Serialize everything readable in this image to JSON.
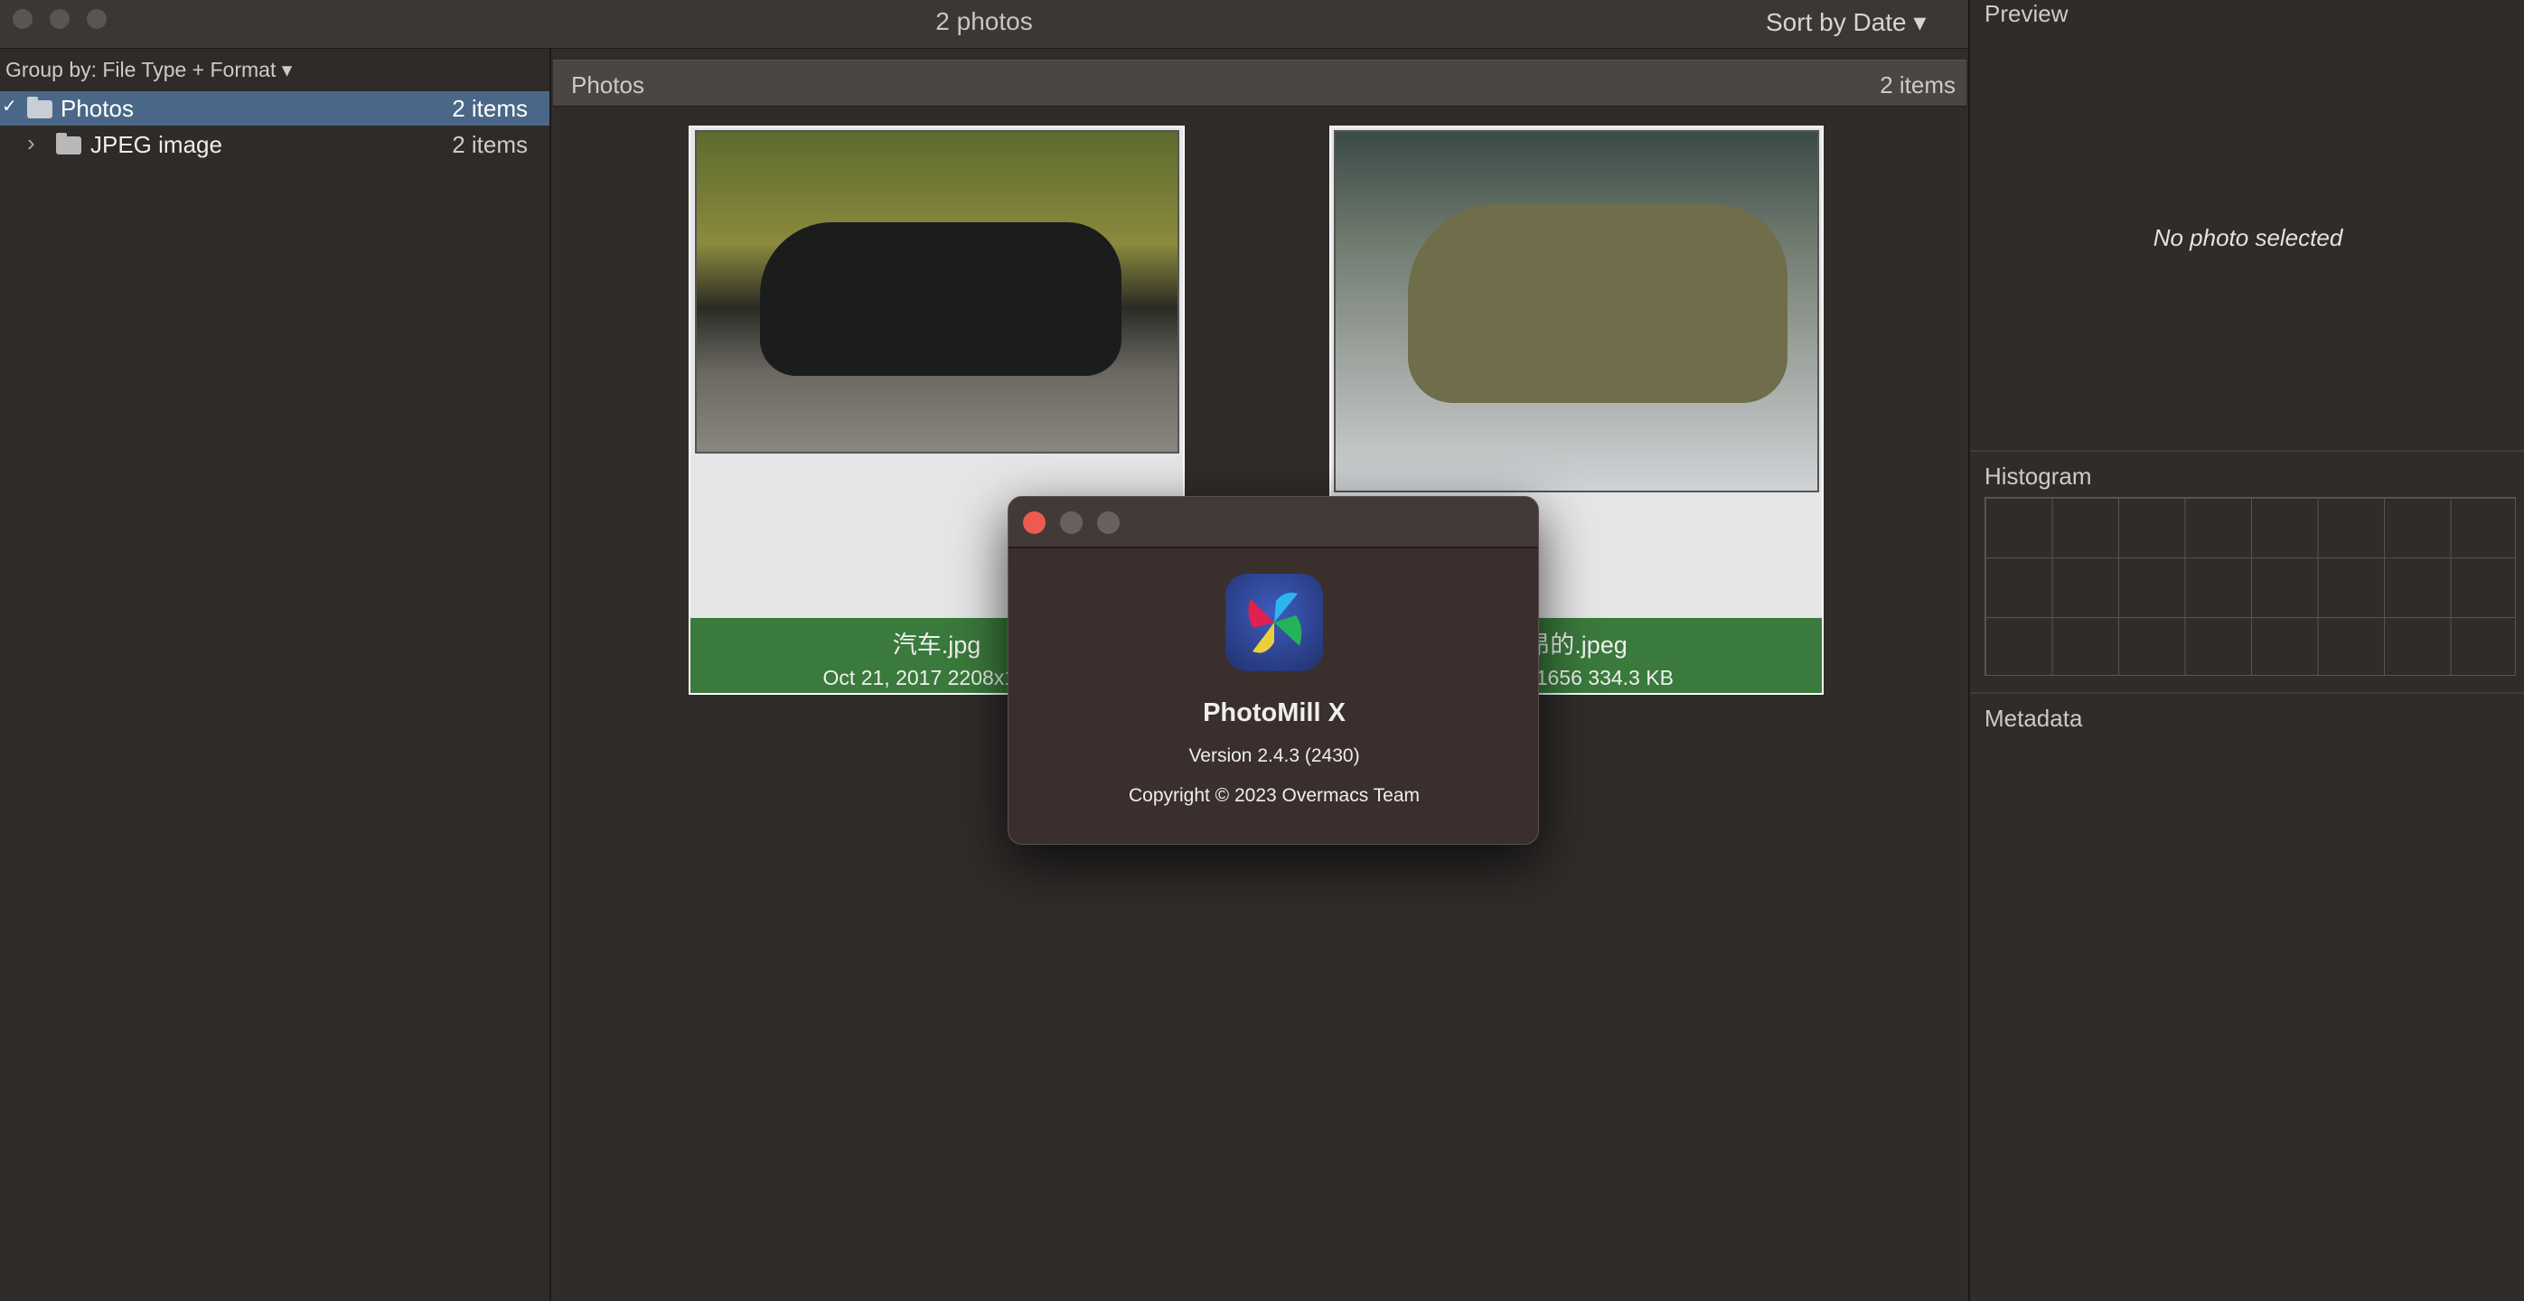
{
  "window": {
    "title": "2 photos",
    "sort_label": "Sort by Date ▾"
  },
  "sidebar": {
    "group_by": "Group by: File Type + Format ▾",
    "items": [
      {
        "label": "Photos",
        "count": "2 items",
        "expanded": true,
        "selected": true
      },
      {
        "label": "JPEG image",
        "count": "2 items",
        "expanded": false,
        "selected": false
      }
    ]
  },
  "main": {
    "header_title": "Photos",
    "header_count": "2 items",
    "photos": [
      {
        "name": "汽车.jpg",
        "meta": "Oct 21, 2017  2208x1472"
      },
      {
        "name": "昂的.jpeg",
        "meta": "2208x1656  334.3 KB"
      }
    ]
  },
  "right": {
    "preview_label": "Preview",
    "no_photo": "No photo selected",
    "histogram_label": "Histogram",
    "metadata_label": "Metadata"
  },
  "about": {
    "app_name": "PhotoMill X",
    "version": "Version 2.4.3 (2430)",
    "copyright": "Copyright © 2023 Overmacs Team"
  },
  "colors": {
    "selection": "#4a6788",
    "caption_green": "#3a7a3c",
    "close_red": "#ee5a4f"
  }
}
